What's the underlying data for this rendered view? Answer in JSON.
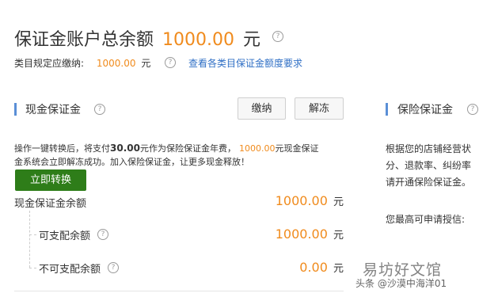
{
  "header": {
    "title_prefix": "保证金账户总余额",
    "title_amount": "1000.00",
    "title_unit": "元",
    "required_label": "类目规定应缴纳:",
    "required_amount": "1000.00",
    "required_unit": "元",
    "view_link": "查看各类目保证金额度要求"
  },
  "cash_section": {
    "title": "现金保证金",
    "pay_button": "缴纳",
    "unfreeze_button": "解冻",
    "notice_part1": "操作一键转换后，将支付",
    "notice_bold_amount": "30.00",
    "notice_part2": "元作为保险保证金年费，",
    "notice_amount": "1000.00",
    "notice_part3": "元现金保证",
    "notice_line2": "金系统会立即解冻成功。加入保险保证金，让更多现金释放！",
    "convert_button": "立即转换",
    "balance_label": "现金保证金余额",
    "balance_amount": "1000.00",
    "balance_unit": "元",
    "available_label": "可支配余额",
    "available_amount": "1000.00",
    "available_unit": "元",
    "unavailable_label": "不可支配余额",
    "unavailable_amount": "0.00",
    "unavailable_unit": "元"
  },
  "insurance_section": {
    "title": "保险保证金",
    "text_line1": "根据您的店铺经营状",
    "text_line2": "分、退款率、纠纷率",
    "text_line3": "请开通保险保证金。",
    "max_credit_label": "您最高可申请授信:"
  },
  "watermark": {
    "line1": "易坊好文馆",
    "line2": "头条 @沙漠中海洋01"
  },
  "colors": {
    "accent_orange": "#f08b1d",
    "link_blue": "#2f6fc5",
    "primary_green": "#2e7d19",
    "section_bar": "#5a8fd6"
  }
}
